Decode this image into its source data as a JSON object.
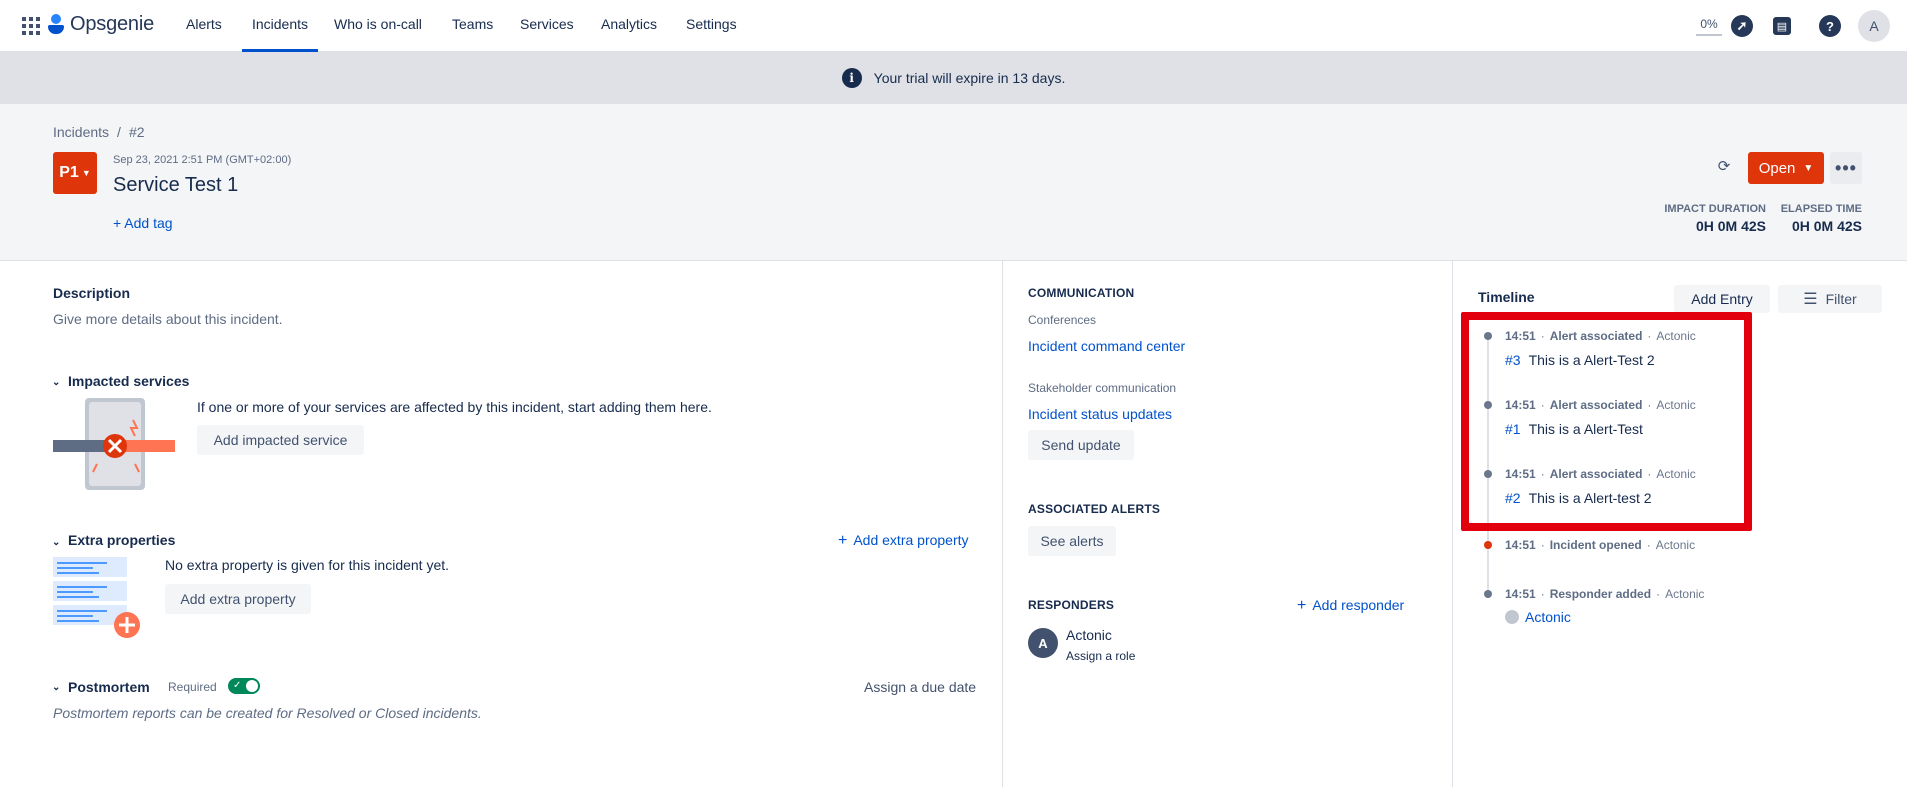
{
  "app": {
    "name": "Opsgenie"
  },
  "nav": {
    "items": [
      "Alerts",
      "Incidents",
      "Who is on-call",
      "Teams",
      "Services",
      "Analytics",
      "Settings"
    ],
    "active": "Incidents",
    "progress_label": "0%",
    "avatar_initial": "A"
  },
  "banner": {
    "text": "Your trial will expire in 13 days."
  },
  "breadcrumb": {
    "root": "Incidents",
    "current": "#2"
  },
  "incident": {
    "priority": "P1",
    "date": "Sep 23, 2021 2:51 PM (GMT+02:00)",
    "title": "Service Test 1",
    "add_tag": "+ Add tag",
    "status": "Open",
    "impact_label": "IMPACT DURATION",
    "impact_value": "0H 0M 42S",
    "elapsed_label": "ELAPSED TIME",
    "elapsed_value": "0H 0M 42S"
  },
  "description": {
    "title": "Description",
    "placeholder": "Give more details about this incident."
  },
  "impacted": {
    "title": "Impacted services",
    "text": "If one or more of your services are affected by this incident, start adding them here.",
    "button": "Add impacted service"
  },
  "extra": {
    "title": "Extra properties",
    "link": "Add extra property",
    "text": "No extra property is given for this incident yet.",
    "button": "Add extra property"
  },
  "postmortem": {
    "title": "Postmortem",
    "required": "Required",
    "due": "Assign a due date",
    "note": "Postmortem reports can be created for Resolved or Closed incidents."
  },
  "communication": {
    "title": "COMMUNICATION",
    "conferences": "Conferences",
    "command_center": "Incident command center",
    "stakeholder": "Stakeholder communication",
    "status_updates": "Incident status updates",
    "send_update": "Send update"
  },
  "alerts": {
    "title": "ASSOCIATED ALERTS",
    "button": "See alerts"
  },
  "responders": {
    "title": "RESPONDERS",
    "add": "Add responder",
    "name": "Actonic",
    "initial": "A",
    "role": "Assign a role"
  },
  "timeline": {
    "title": "Timeline",
    "add_entry": "Add Entry",
    "filter": "Filter",
    "entries": [
      {
        "time": "14:51",
        "event": "Alert associated",
        "actor": "Actonic",
        "num": "#3",
        "text": "This is a Alert-Test 2"
      },
      {
        "time": "14:51",
        "event": "Alert associated",
        "actor": "Actonic",
        "num": "#1",
        "text": "This is a Alert-Test"
      },
      {
        "time": "14:51",
        "event": "Alert associated",
        "actor": "Actonic",
        "num": "#2",
        "text": "This is a Alert-test 2"
      },
      {
        "time": "14:51",
        "event": "Incident opened",
        "actor": "Actonic"
      },
      {
        "time": "14:51",
        "event": "Responder added",
        "actor": "Actonic",
        "user": "Actonic"
      }
    ]
  },
  "colors": {
    "accent": "#0052cc",
    "danger": "#de350b",
    "highlight": "#e2000f",
    "success": "#00875a"
  }
}
